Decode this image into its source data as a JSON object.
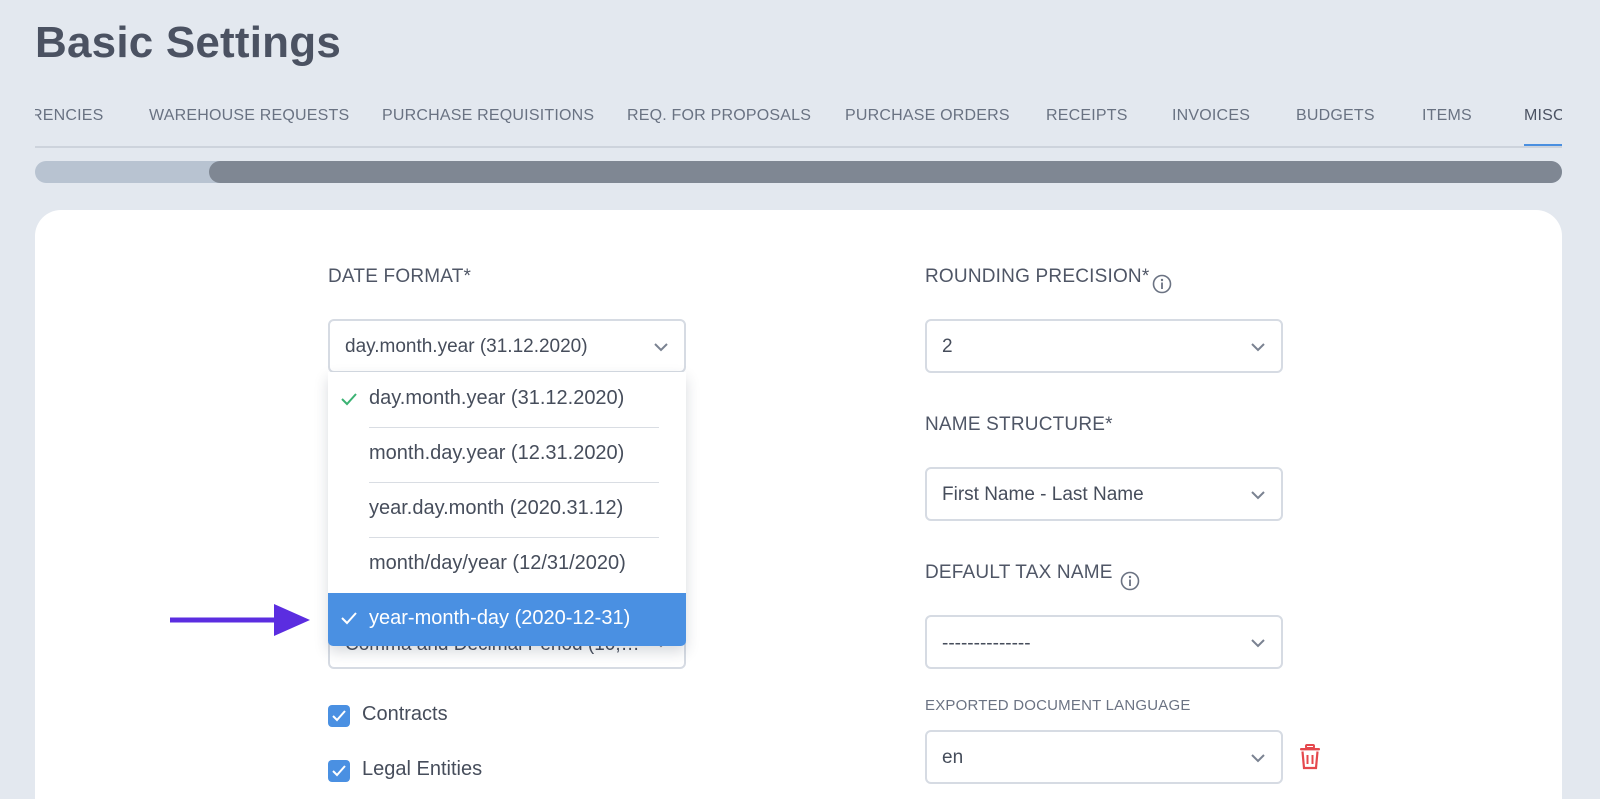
{
  "page": {
    "title": "Basic Settings"
  },
  "tabs": [
    {
      "label": "RENCIES"
    },
    {
      "label": "WAREHOUSE REQUESTS"
    },
    {
      "label": "PURCHASE REQUISITIONS"
    },
    {
      "label": "REQ. FOR PROPOSALS"
    },
    {
      "label": "PURCHASE ORDERS"
    },
    {
      "label": "RECEIPTS"
    },
    {
      "label": "INVOICES"
    },
    {
      "label": "BUDGETS"
    },
    {
      "label": "ITEMS"
    },
    {
      "label": "MISC"
    }
  ],
  "active_tab": "MISC",
  "date_format": {
    "label": "DATE FORMAT*",
    "value": "day.month.year (31.12.2020)",
    "options": [
      {
        "label": "day.month.year (31.12.2020)",
        "selected": true
      },
      {
        "label": "month.day.year (12.31.2020)"
      },
      {
        "label": "year.day.month (2020.31.12)"
      },
      {
        "label": "month/day/year (12/31/2020)"
      },
      {
        "label": "year-month-day (2020-12-31)",
        "highlighted": true
      }
    ]
  },
  "number_format": {
    "value": "Comma and Decimal Period (10,…"
  },
  "checkboxes": [
    {
      "label": "Contracts",
      "checked": true
    },
    {
      "label": "Legal Entities",
      "checked": true
    }
  ],
  "rounding_precision": {
    "label": "ROUNDING PRECISION*",
    "value": "2"
  },
  "name_structure": {
    "label": "NAME STRUCTURE*",
    "value": "First Name - Last Name"
  },
  "default_tax_name": {
    "label": "DEFAULT TAX NAME",
    "value": "--------------"
  },
  "exported_language": {
    "label": "EXPORTED DOCUMENT LANGUAGE",
    "value": "en"
  },
  "colors": {
    "accent": "#4a90e2",
    "check_green": "#3bb273",
    "arrow": "#5b2de0",
    "delete_red": "#e5484d"
  }
}
